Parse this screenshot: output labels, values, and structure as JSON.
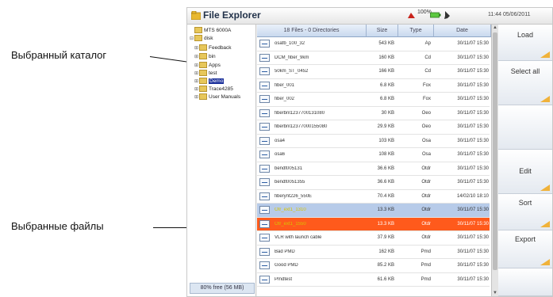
{
  "callouts": {
    "selected_dir": "Выбранный каталог",
    "selected_files": "Выбранные файлы"
  },
  "window": {
    "title": "File Explorer",
    "battery": "100%",
    "clock": "11:44 05/06/2011"
  },
  "tree": {
    "items": [
      {
        "label": "MTS 6000A",
        "expander": "",
        "selected": false
      },
      {
        "label": "disk",
        "expander": "⊟",
        "selected": false
      },
      {
        "label": "Feedback",
        "expander": "⊞",
        "selected": false
      },
      {
        "label": "bin",
        "expander": "⊞",
        "selected": false
      },
      {
        "label": "Apps",
        "expander": "⊞",
        "selected": false
      },
      {
        "label": "test",
        "expander": "⊞",
        "selected": false
      },
      {
        "label": "Demo",
        "expander": "⊞",
        "selected": true
      },
      {
        "label": "Trace4285",
        "expander": "⊞",
        "selected": false
      },
      {
        "label": "User Manuals",
        "expander": "⊞",
        "selected": false
      }
    ],
    "free_space": "80% free (56 MB)"
  },
  "table": {
    "headers": [
      "18 Files - 0 Directories",
      "Size",
      "Type",
      "Date"
    ],
    "rows": [
      {
        "name": "osafb_100_32",
        "size": "543 KB",
        "type": "Ap",
        "date": "30/11/07 15:30",
        "state": ""
      },
      {
        "name": "DCM_fiber_9km",
        "size": "160 KB",
        "type": "Cd",
        "date": "30/11/07 15:30",
        "state": ""
      },
      {
        "name": "50km_ST_0452",
        "size": "166 KB",
        "type": "Cd",
        "date": "30/11/07 15:30",
        "state": ""
      },
      {
        "name": "fiber_001",
        "size": "6.8 KB",
        "type": "Fox",
        "date": "30/11/07 15:30",
        "state": ""
      },
      {
        "name": "fiber_002",
        "size": "6.8 KB",
        "type": "Fox",
        "date": "30/11/07 15:30",
        "state": ""
      },
      {
        "name": "fiberbnl1237700131080",
        "size": "30 KB",
        "type": "Oeo",
        "date": "30/11/07 15:30",
        "state": ""
      },
      {
        "name": "fiberbnl12377000155080",
        "size": "29.9 KB",
        "type": "Oeo",
        "date": "30/11/07 15:30",
        "state": ""
      },
      {
        "name": "osa4",
        "size": "103 KB",
        "type": "Osa",
        "date": "30/11/07 15:30",
        "state": ""
      },
      {
        "name": "osa6",
        "size": "108 KB",
        "type": "Osa",
        "date": "30/11/07 15:30",
        "state": ""
      },
      {
        "name": "bendt005131",
        "size": "36.6 KB",
        "type": "Otdr",
        "date": "30/11/07 15:30",
        "state": ""
      },
      {
        "name": "bendt0051355",
        "size": "36.6 KB",
        "type": "Otdr",
        "date": "30/11/07 15:30",
        "state": ""
      },
      {
        "name": "fiberynt226_550E",
        "size": "70.4 KB",
        "type": "Otdr",
        "date": "14/02/10 18:10",
        "state": ""
      },
      {
        "name": "Otr_ext1_1310",
        "size": "13.3 KB",
        "type": "Otdr",
        "date": "30/11/07 15:30",
        "state": "sel1"
      },
      {
        "name": "Otr_ext1_1550",
        "size": "13.3 KB",
        "type": "Otdr",
        "date": "30/11/07 15:30",
        "state": "sel2"
      },
      {
        "name": "VLR with launch cable",
        "size": "37.9 KB",
        "type": "Otdr",
        "date": "30/11/07 15:30",
        "state": ""
      },
      {
        "name": "Bad PMD",
        "size": "162 KB",
        "type": "Pmd",
        "date": "30/11/07 15:30",
        "state": ""
      },
      {
        "name": "Good PMD",
        "size": "85.2 KB",
        "type": "Pmd",
        "date": "30/11/07 15:30",
        "state": ""
      },
      {
        "name": "Pmdtest",
        "size": "61.6 KB",
        "type": "Pmd",
        "date": "30/11/07 15:30",
        "state": ""
      }
    ]
  },
  "softkeys": {
    "load": "Load",
    "select_all": "Select all",
    "edit": "Edit",
    "sort": "Sort",
    "export": "Export"
  },
  "colors": {
    "selected_primary": "#ff5a1c",
    "selected_secondary": "#b7cbe9",
    "tree_selected": "#1a2f9a",
    "softkey_accent": "#f0b23a"
  }
}
